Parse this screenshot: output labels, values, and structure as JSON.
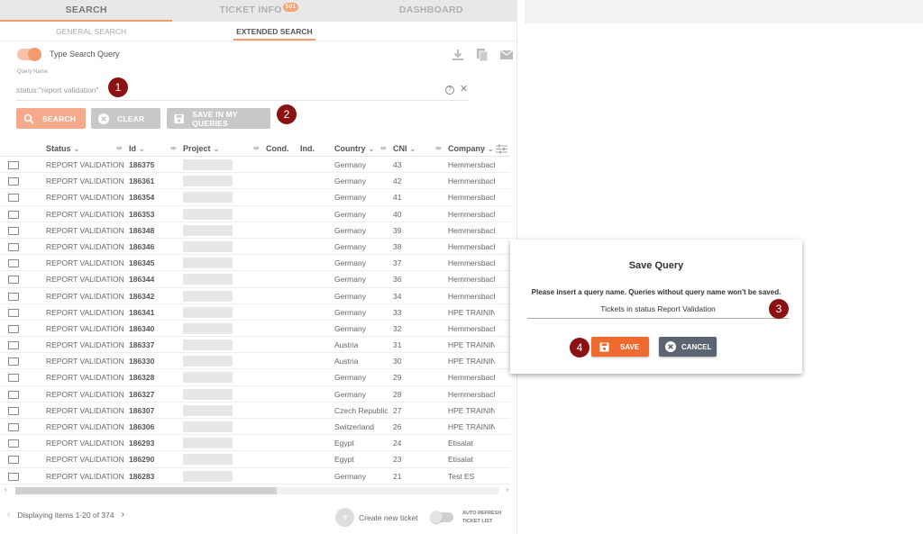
{
  "top_tabs": [
    {
      "label": "SEARCH",
      "active": true
    },
    {
      "label": "TICKET INFO",
      "badge": "501",
      "active": false
    },
    {
      "label": "DASHBOARD",
      "active": false
    }
  ],
  "sub_tabs": [
    {
      "label": "GENERAL SEARCH",
      "active": false
    },
    {
      "label": "EXTENDED SEARCH",
      "active": true
    }
  ],
  "search": {
    "toggle_label": "Type Search Query",
    "toggle_on": true,
    "query_name_label": "Query Name",
    "query_value": "status:\"report validation\"",
    "help": "?",
    "clear": "✕"
  },
  "buttons": {
    "search": "SEARCH",
    "clear": "CLEAR",
    "save_in_my_queries": "SAVE IN MY QUERIES"
  },
  "callouts": [
    "1",
    "2",
    "3",
    "4"
  ],
  "table": {
    "columns": [
      "Status",
      "Id",
      "Project",
      "Cond.",
      "Ind.",
      "Country",
      "CNI",
      "Company"
    ],
    "rows": [
      {
        "status": "REPORT VALIDATION",
        "id": "186375",
        "country": "Germany",
        "cni": "43",
        "company": "Hemmersbach"
      },
      {
        "status": "REPORT VALIDATION",
        "id": "186361",
        "country": "Germany",
        "cni": "42",
        "company": "Hemmersbach"
      },
      {
        "status": "REPORT VALIDATION",
        "id": "186354",
        "country": "Germany",
        "cni": "41",
        "company": "Hemmersbach"
      },
      {
        "status": "REPORT VALIDATION",
        "id": "186353",
        "country": "Germany",
        "cni": "40",
        "company": "Hemmersbach"
      },
      {
        "status": "REPORT VALIDATION",
        "id": "186348",
        "country": "Germany",
        "cni": "39",
        "company": "Hemmersbach"
      },
      {
        "status": "REPORT VALIDATION",
        "id": "186346",
        "country": "Germany",
        "cni": "38",
        "company": "Hemmersbach"
      },
      {
        "status": "REPORT VALIDATION",
        "id": "186345",
        "country": "Germany",
        "cni": "37",
        "company": "Hemmersbach"
      },
      {
        "status": "REPORT VALIDATION",
        "id": "186344",
        "country": "Germany",
        "cni": "36",
        "company": "Hemmersbach"
      },
      {
        "status": "REPORT VALIDATION",
        "id": "186342",
        "country": "Germany",
        "cni": "34",
        "company": "Hemmersbach"
      },
      {
        "status": "REPORT VALIDATION",
        "id": "186341",
        "country": "Germany",
        "cni": "33",
        "company": "HPE TRAINING"
      },
      {
        "status": "REPORT VALIDATION",
        "id": "186340",
        "country": "Germany",
        "cni": "32",
        "company": "Hemmersbach"
      },
      {
        "status": "REPORT VALIDATION",
        "id": "186337",
        "country": "Austria",
        "cni": "31",
        "company": "HPE TRAINING"
      },
      {
        "status": "REPORT VALIDATION",
        "id": "186330",
        "country": "Austria",
        "cni": "30",
        "company": "HPE TRAINING"
      },
      {
        "status": "REPORT VALIDATION",
        "id": "186328",
        "country": "Germany",
        "cni": "29",
        "company": "Hemmersbach"
      },
      {
        "status": "REPORT VALIDATION",
        "id": "186327",
        "country": "Germany",
        "cni": "28",
        "company": "Hemmersbach"
      },
      {
        "status": "REPORT VALIDATION",
        "id": "186307",
        "country": "Czech Republic",
        "cni": "27",
        "company": "HPE TRAINING"
      },
      {
        "status": "REPORT VALIDATION",
        "id": "186306",
        "country": "Switzerland",
        "cni": "26",
        "company": "HPE TRAINING"
      },
      {
        "status": "REPORT VALIDATION",
        "id": "186293",
        "country": "Egypt",
        "cni": "24",
        "company": "Etisalat"
      },
      {
        "status": "REPORT VALIDATION",
        "id": "186290",
        "country": "Egypt",
        "cni": "23",
        "company": "Etisalat"
      },
      {
        "status": "REPORT VALIDATION",
        "id": "186283",
        "country": "Germany",
        "cni": "21",
        "company": "Test ES"
      }
    ]
  },
  "footer": {
    "pager_text": "Displaying items 1-20 of 374",
    "create_ticket": "Create new ticket",
    "auto_refresh": "AUTO REFRESH TICKET LIST",
    "auto_refresh_on": false
  },
  "dialog": {
    "title": "Save Query",
    "message": "Please insert a query name. Queries without query name won't be saved.",
    "query_name_value": "Tickets in status Report Validation",
    "save": "SAVE",
    "cancel": "CANCEL"
  },
  "colors": {
    "accent": "#f59a72",
    "save": "#ee6a2e",
    "cancel": "#5b6470",
    "callout": "#8b1212"
  }
}
